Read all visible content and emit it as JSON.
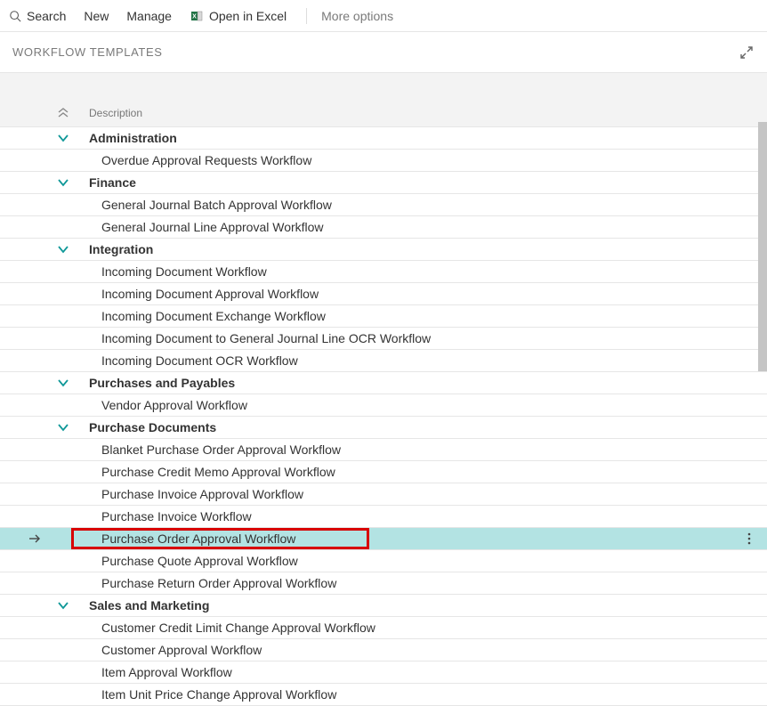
{
  "toolbar": {
    "search": "Search",
    "new": "New",
    "manage": "Manage",
    "open_excel": "Open in Excel",
    "more": "More options"
  },
  "page": {
    "title": "WORKFLOW TEMPLATES"
  },
  "column_header": {
    "description": "Description"
  },
  "groups": [
    {
      "name": "Administration",
      "items": [
        "Overdue Approval Requests Workflow"
      ]
    },
    {
      "name": "Finance",
      "items": [
        "General Journal Batch Approval Workflow",
        "General Journal Line Approval Workflow"
      ]
    },
    {
      "name": "Integration",
      "items": [
        "Incoming Document Workflow",
        "Incoming Document Approval Workflow",
        "Incoming Document Exchange Workflow",
        "Incoming Document to General Journal Line OCR Workflow",
        "Incoming Document OCR Workflow"
      ]
    },
    {
      "name": "Purchases and Payables",
      "items": [
        "Vendor Approval Workflow"
      ]
    },
    {
      "name": "Purchase Documents",
      "items": [
        "Blanket Purchase Order Approval Workflow",
        "Purchase Credit Memo Approval Workflow",
        "Purchase Invoice Approval Workflow",
        "Purchase Invoice Workflow",
        "Purchase Order Approval Workflow",
        "Purchase Quote Approval Workflow",
        "Purchase Return Order Approval Workflow"
      ]
    },
    {
      "name": "Sales and Marketing",
      "items": [
        "Customer Credit Limit Change Approval Workflow",
        "Customer Approval Workflow",
        "Item Approval Workflow",
        "Item Unit Price Change Approval Workflow"
      ]
    }
  ],
  "selected_item": "Purchase Order Approval Workflow"
}
